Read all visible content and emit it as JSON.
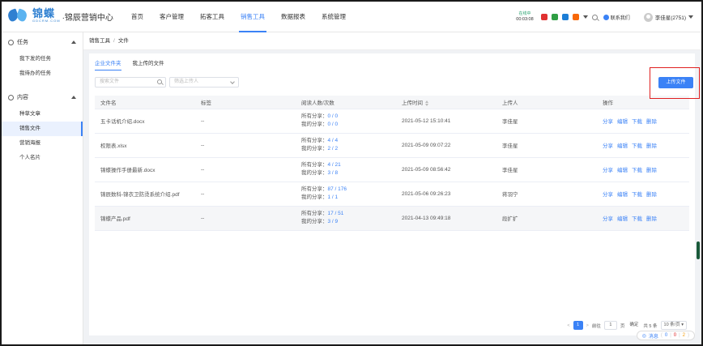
{
  "header": {
    "logo_cn": "锦蝶",
    "logo_en": "GDCRM.COM",
    "logo_sub": "·锦辰营销中心",
    "nav": [
      {
        "label": "首页",
        "active": false
      },
      {
        "label": "客户管理",
        "active": false
      },
      {
        "label": "拓客工具",
        "active": false
      },
      {
        "label": "销售工具",
        "active": true
      },
      {
        "label": "数据报表",
        "active": false
      },
      {
        "label": "系统管理",
        "active": false
      }
    ],
    "online_status": "在线中",
    "online_time": "00:03:08",
    "contact_label": "联系我们",
    "user_name": "李佳星(2751)"
  },
  "sidebar": {
    "groups": [
      {
        "label": "任务",
        "items": [
          {
            "label": "我下发的任务",
            "active": false
          },
          {
            "label": "我待办的任务",
            "active": false
          }
        ]
      },
      {
        "label": "内容",
        "items": [
          {
            "label": "种草文章",
            "active": false
          },
          {
            "label": "销售文件",
            "active": true
          },
          {
            "label": "营销海报",
            "active": false
          },
          {
            "label": "个人名片",
            "active": false
          }
        ]
      }
    ]
  },
  "breadcrumb": {
    "parent": "销售工具",
    "sep": "/",
    "current": "文件"
  },
  "tabs": [
    {
      "label": "企业文件夹",
      "active": true
    },
    {
      "label": "我上传的文件",
      "active": false
    }
  ],
  "filters": {
    "search_placeholder": "搜索文件",
    "uploader_placeholder": "筛选上传人"
  },
  "upload_label": "上传文件",
  "table": {
    "columns": [
      "文件名",
      "标签",
      "阅读人数/次数",
      "上传时间",
      "上传人",
      "操作"
    ],
    "all_share_label": "所有分享：",
    "my_share_label": "我的分享：",
    "ops": [
      "分享",
      "编辑",
      "下载",
      "删除"
    ],
    "rows": [
      {
        "name": "五卡话机介绍.docx",
        "tag": "--",
        "all": "0 / 0",
        "mine": "0 / 0",
        "time": "2021-05-12 15:10:41",
        "uploader": "李佳星",
        "hl": false
      },
      {
        "name": "权限表.xlsx",
        "tag": "--",
        "all": "4 / 4",
        "mine": "2 / 2",
        "time": "2021-05-09 09:07:22",
        "uploader": "李佳星",
        "hl": false
      },
      {
        "name": "锦蝶操作手册最新.docx",
        "tag": "--",
        "all": "4 / 21",
        "mine": "3 / 8",
        "time": "2021-05-09 08:56:42",
        "uploader": "李佳星",
        "hl": false
      },
      {
        "name": "锦辰数科-锦衣卫防烫系统介绍.pdf",
        "tag": "--",
        "all": "87 / 176",
        "mine": "1 / 1",
        "time": "2021-05-06 09:26:23",
        "uploader": "蒋羽宁",
        "hl": false
      },
      {
        "name": "锦蝶产品.pdf",
        "tag": "--",
        "all": "17 / 51",
        "mine": "3 / 9",
        "time": "2021-04-13 09:49:18",
        "uploader": "段扩扩",
        "hl": true
      }
    ]
  },
  "pager": {
    "prev": "<",
    "current": "1",
    "next": ">",
    "goto": "前往",
    "goto_value": "1",
    "page_unit": "页",
    "confirm": "确定",
    "total": "共 5 条",
    "page_size": "10 条/页"
  },
  "messages": {
    "label": "消息",
    "n1": "0",
    "n2": "0",
    "n3": "2"
  }
}
